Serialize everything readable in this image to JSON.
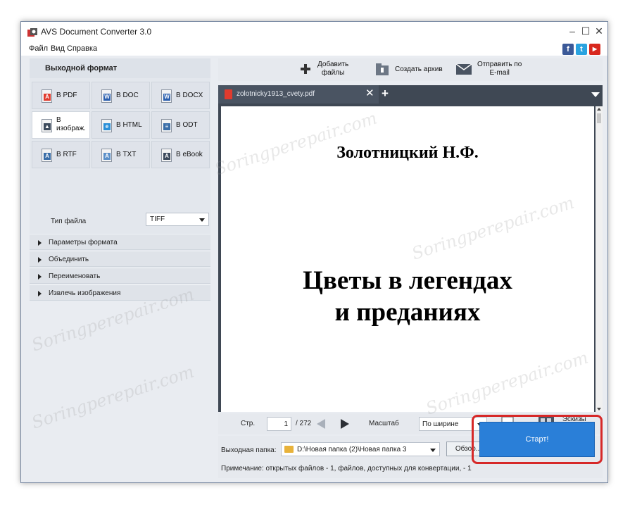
{
  "window": {
    "title": "AVS Document Converter 3.0"
  },
  "menu": [
    "Файл",
    "Вид",
    "Справка"
  ],
  "social": [
    "f",
    "t",
    "▶"
  ],
  "left": {
    "header": "Выходной формат",
    "formats": [
      {
        "label": "В PDF",
        "icon": "pdf-icon",
        "color": "#e03b2e",
        "badge": "A"
      },
      {
        "label": "В DOC",
        "icon": "doc-icon",
        "color": "#2b5fae",
        "badge": "W"
      },
      {
        "label": "В DOCX",
        "icon": "docx-icon",
        "color": "#2b5fae",
        "badge": "W"
      },
      {
        "label": "В изображ.",
        "icon": "image-icon",
        "color": "#3c4a5c",
        "badge": "▲"
      },
      {
        "label": "В HTML",
        "icon": "html-icon",
        "color": "#2a8fd8",
        "badge": "e"
      },
      {
        "label": "В ODT",
        "icon": "odt-icon",
        "color": "#3a6ea8",
        "badge": "≡"
      },
      {
        "label": "В RTF",
        "icon": "rtf-icon",
        "color": "#3a6ea8",
        "badge": "A"
      },
      {
        "label": "В TXT",
        "icon": "txt-icon",
        "color": "#5b8fc8",
        "badge": "A"
      },
      {
        "label": "В eBook",
        "icon": "ebook-icon",
        "color": "#3c4a5c",
        "badge": "A"
      }
    ],
    "filetype_label": "Тип файла",
    "filetype_value": "TIFF",
    "accordion": [
      "Параметры формата",
      "Объединить",
      "Переименовать",
      "Извлечь изображения"
    ]
  },
  "toolbar": {
    "add": "Добавить\nфайлы",
    "archive": "Создать архив",
    "email": "Отправить по\nE-mail"
  },
  "tab": {
    "filename": "zolotnicky1913_cvety.pdf"
  },
  "document": {
    "author": "Золотницкий Н.Ф.",
    "title_line1": "Цветы в легендах",
    "title_line2": "и преданиях"
  },
  "nav": {
    "page_label": "Стр.",
    "page_value": "1",
    "page_total": "/ 272",
    "zoom_label": "Масштаб",
    "zoom_value": "По ширине",
    "thumbnails": "Эскизы\nстраниц"
  },
  "output": {
    "label": "Выходная папка:",
    "path": "D:\\Новая папка (2)\\Новая папка 3",
    "browse": "Обзор...",
    "note": "Примечание: открытых файлов - 1, файлов, доступных для конвертации, - 1",
    "start": "Старт!"
  },
  "watermark": "Soringperepair.com"
}
